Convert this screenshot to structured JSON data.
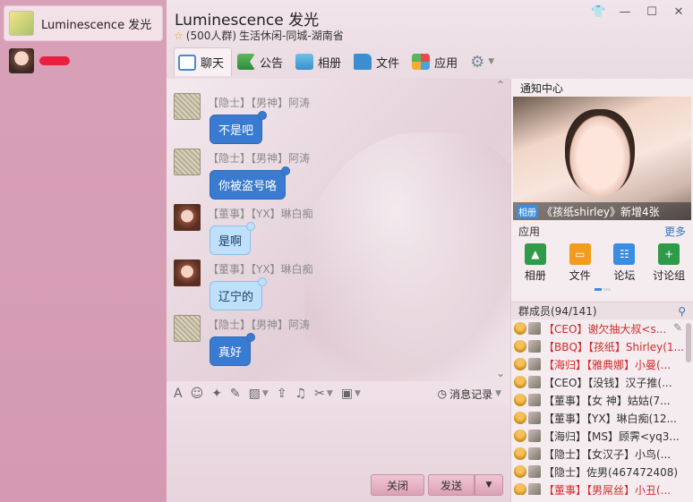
{
  "sidebar": {
    "items": [
      {
        "label": "Luminescence 发光"
      },
      {
        "label": ""
      }
    ]
  },
  "header": {
    "title": "Luminescence 发光",
    "subtitle_count": "(500人群)",
    "subtitle_category": "生活休闲-同城-湖南省"
  },
  "tabs": [
    {
      "label": "聊天"
    },
    {
      "label": "公告"
    },
    {
      "label": "相册"
    },
    {
      "label": "文件"
    },
    {
      "label": "应用"
    }
  ],
  "messages": [
    {
      "sender": "【隐士】【男神】阿涛",
      "text": "不是吧",
      "style": "dark"
    },
    {
      "sender": "【隐士】【男神】阿涛",
      "text": "你被盗号咯",
      "style": "dark"
    },
    {
      "sender": "【董事】【YX】琳白痴",
      "text": "是啊",
      "style": "light"
    },
    {
      "sender": "【董事】【YX】琳白痴",
      "text": "辽宁的",
      "style": "light"
    },
    {
      "sender": "【隐士】【男神】阿涛",
      "text": "真好",
      "style": "dark"
    }
  ],
  "toolbar": {
    "history_label": "消息记录"
  },
  "buttons": {
    "close": "关闭",
    "send": "发送"
  },
  "right_panel": {
    "notice_title": "通知中心",
    "photo_tag": "相册",
    "photo_caption": "《孩纸shirley》新增4张",
    "apps_title": "应用",
    "apps_more": "更多",
    "apps": [
      "相册",
      "文件",
      "论坛",
      "讨论组"
    ],
    "members_title": "群成员(94/141)",
    "members": [
      {
        "text": "【CEO】谢欠抽大叔<s...",
        "red": true
      },
      {
        "text": "【BBQ】【孩纸】Shirley(1...",
        "red": true
      },
      {
        "text": "【海归】【雅典娜】小曼(...",
        "red": true
      },
      {
        "text": "【CEO】【没钱】汉子推(...",
        "red": false
      },
      {
        "text": "【董事】【女 神】姑姑(7...",
        "red": false
      },
      {
        "text": "【董事】【YX】琳白痴(12...",
        "red": false
      },
      {
        "text": "【海归】【MS】顾霁<yq3...",
        "red": false
      },
      {
        "text": "【隐士】【女汉子】小鸟(...",
        "red": false
      },
      {
        "text": "【隐士】佐男(467472408)",
        "red": false
      },
      {
        "text": "【董事】【男屌丝】小丑(...",
        "red": true
      }
    ]
  }
}
